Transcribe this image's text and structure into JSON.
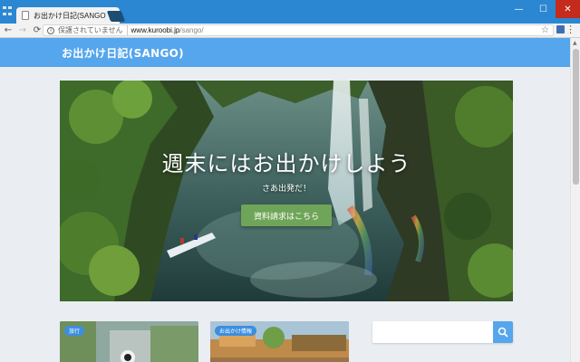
{
  "browser": {
    "tab_title": "お出かけ日記(SANGO) | お出かけ",
    "tab_close": "×",
    "window_controls": {
      "minimize": "—",
      "maximize": "☐",
      "close": "✕"
    },
    "nav": {
      "back": "←",
      "forward": "→",
      "reload": "⟳"
    },
    "address": {
      "security_label": "保護されていません",
      "host": "www.kuroobi.jp",
      "path": "/sango/"
    },
    "star": "☆",
    "menu": "⋮"
  },
  "site": {
    "title": "お出かけ日記(SANGO)",
    "header_color": "#55a6ec"
  },
  "hero": {
    "title": "週末にはお出かけしよう",
    "subtitle": "さあ出発だ！",
    "button_label": "資料請求はこちら",
    "button_color": "#6fa558"
  },
  "cards": [
    {
      "category": "旅行"
    },
    {
      "category": "お出かけ情報"
    }
  ],
  "search": {
    "placeholder": "",
    "button_color": "#55a6ec",
    "icon": "search-icon"
  }
}
